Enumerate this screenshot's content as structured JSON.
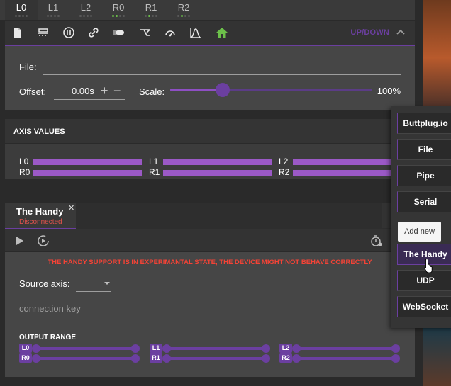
{
  "axis_tabs": [
    {
      "label": "L0",
      "active": true,
      "dots": [
        false,
        false,
        false,
        false
      ]
    },
    {
      "label": "L1",
      "active": false,
      "dots": [
        false,
        false,
        false,
        false
      ]
    },
    {
      "label": "L2",
      "active": false,
      "dots": [
        false,
        false,
        false,
        false
      ]
    },
    {
      "label": "R0",
      "active": false,
      "dots": [
        true,
        true,
        false,
        false
      ]
    },
    {
      "label": "R1",
      "active": false,
      "dots": [
        false,
        true,
        false,
        false
      ]
    },
    {
      "label": "R2",
      "active": false,
      "dots": [
        false,
        true,
        false,
        false
      ]
    }
  ],
  "toolbar": {
    "icons": [
      "file-icon",
      "scan-icon",
      "pause-circle-icon",
      "link-icon",
      "pill-icon",
      "fork-icon",
      "speedometer-icon",
      "chart-icon",
      "home-icon"
    ],
    "updown_label": "UP/DOWN",
    "accent": "#6b3fa0",
    "home_color": "#6cc04a"
  },
  "media": {
    "file_label": "File:",
    "offset_label": "Offset:",
    "offset_value": "0.00s",
    "scale_label": "Scale:",
    "scale_value": "100%",
    "scale_position": 0.26
  },
  "axis_values": {
    "title": "AXIS VALUES",
    "items": [
      {
        "name": "L0"
      },
      {
        "name": "L1"
      },
      {
        "name": "L2"
      },
      {
        "name": "R0"
      },
      {
        "name": "R1"
      },
      {
        "name": "R2"
      }
    ]
  },
  "device": {
    "name": "The Handy",
    "status": "Disconnected",
    "add_label": "+",
    "warning": "THE HANDY SUPPORT IS IN EXPERIMANTAL STATE, THE DEVICE MIGHT NOT BEHAVE CORRECTLY",
    "source_axis_label": "Source axis:",
    "source_axis_value": "",
    "connection_placeholder": "connection key",
    "output_range_title": "OUTPUT RANGE",
    "ranges": [
      {
        "axis": "L0",
        "min": 0,
        "max": 1
      },
      {
        "axis": "L1",
        "min": 0,
        "max": 1
      },
      {
        "axis": "L2",
        "min": 0,
        "max": 1
      },
      {
        "axis": "R0",
        "min": 0,
        "max": 1
      },
      {
        "axis": "R1",
        "min": 0,
        "max": 1
      },
      {
        "axis": "R2",
        "min": 0,
        "max": 1
      }
    ]
  },
  "popup": {
    "items": [
      "Buttplug.io",
      "File",
      "Pipe",
      "Serial",
      "The Handy",
      "UDP",
      "WebSocket"
    ],
    "active": "The Handy",
    "tooltip": "Add new"
  }
}
